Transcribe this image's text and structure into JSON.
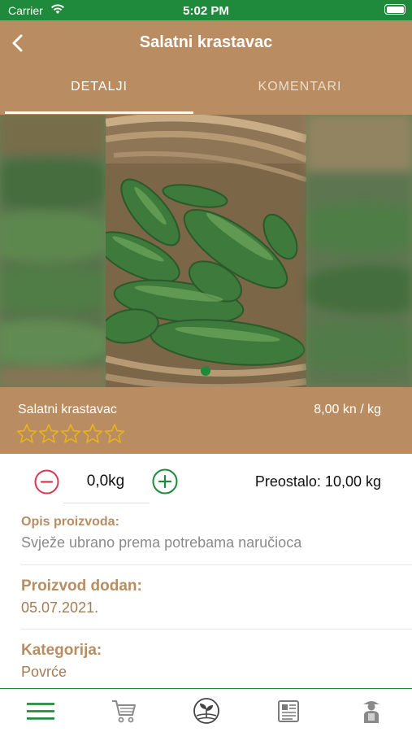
{
  "status_bar": {
    "carrier": "Carrier",
    "time": "5:02 PM"
  },
  "header": {
    "title": "Salatni krastavac",
    "tabs": [
      {
        "label": "DETALJI",
        "active": true
      },
      {
        "label": "KOMENTARI",
        "active": false
      }
    ]
  },
  "gallery": {
    "images_count_visible": 1,
    "current_index": 0
  },
  "product": {
    "name": "Salatni krastavac",
    "price": "8,00 kn / kg",
    "rating": 0,
    "rating_max": 5
  },
  "quantity": {
    "value": "0,0kg",
    "remaining": "Preostalo: 10,00 kg"
  },
  "details": {
    "description_label": "Opis proizvoda:",
    "description_value": "Svježe ubrano prema potrebama naručioca",
    "added_label": "Proizvod dodan:",
    "added_value": "05.07.2021.",
    "category_label": "Kategorija:",
    "category_value": "Povrće"
  },
  "tabbar": {
    "items": [
      "menu-icon",
      "cart-icon",
      "seedling-icon",
      "news-icon",
      "farmer-icon"
    ]
  },
  "colors": {
    "accent_green": "#1f8a3c",
    "brand_brown": "#b98d61",
    "minus_red": "#d9364f",
    "star_gold": "#e8b41a"
  }
}
